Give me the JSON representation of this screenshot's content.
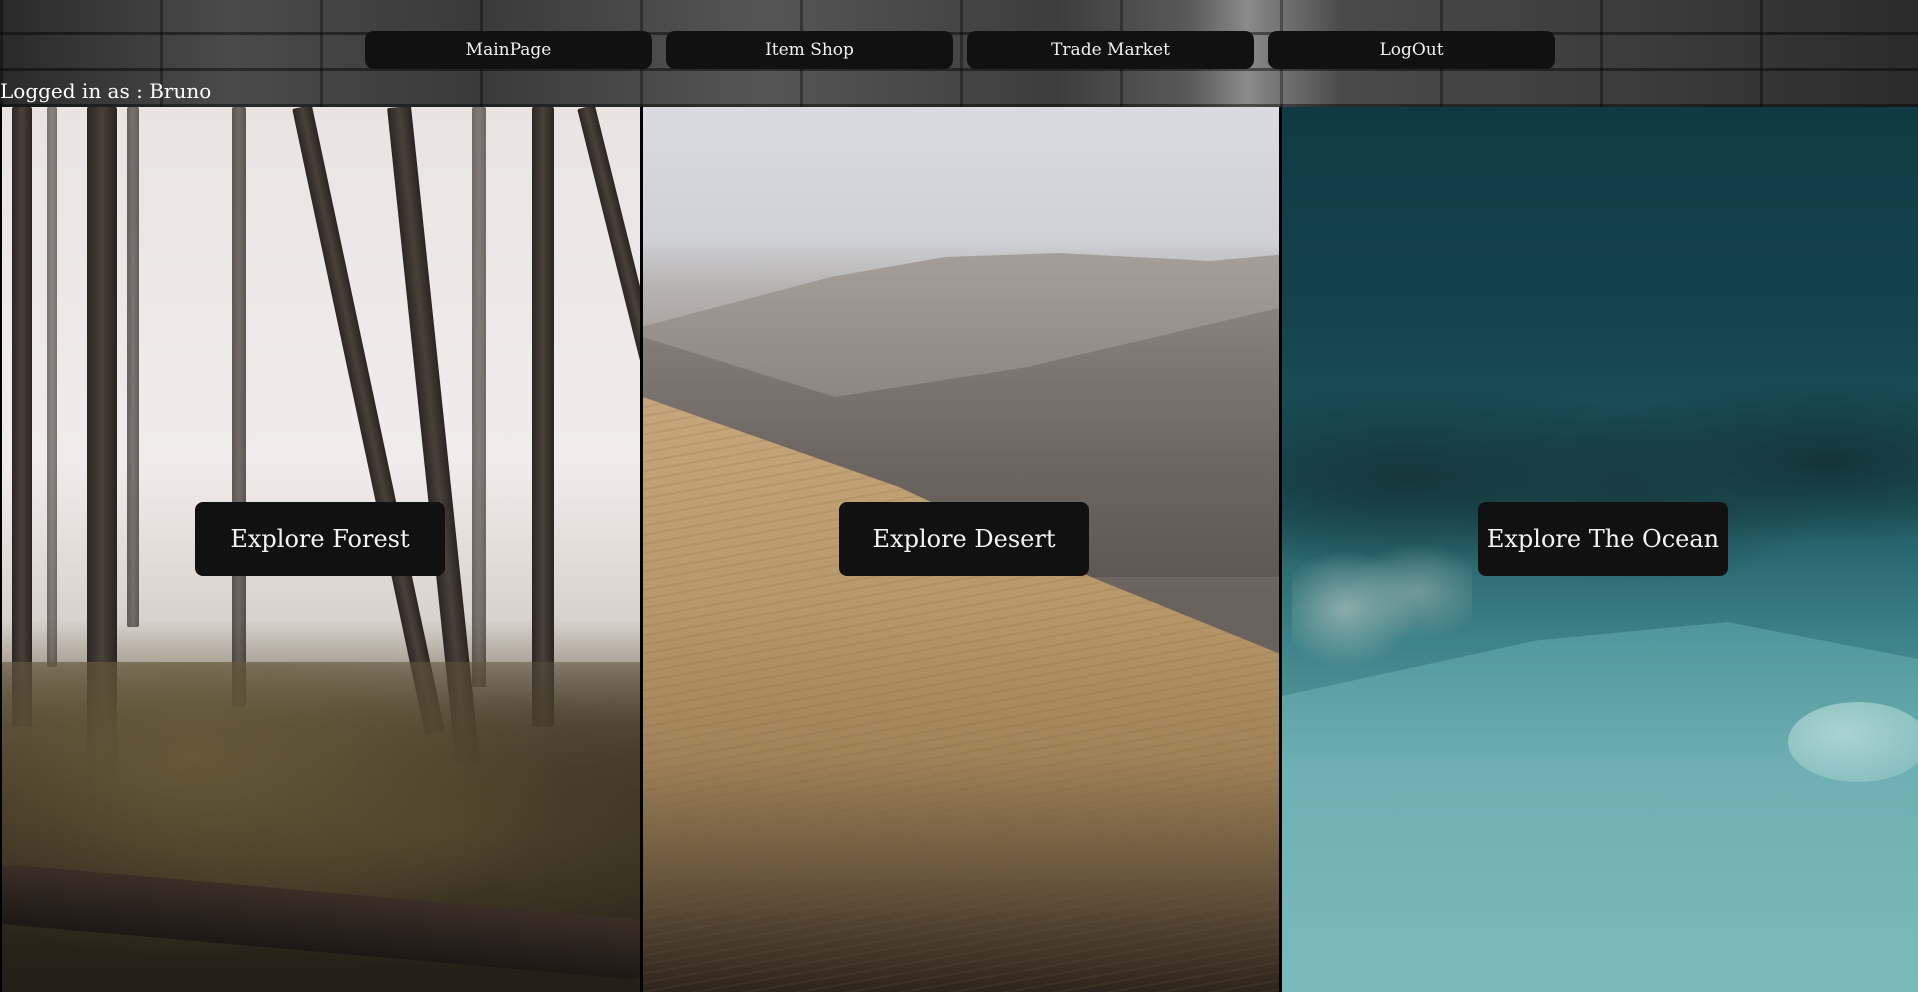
{
  "nav": {
    "items": [
      {
        "label": "MainPage"
      },
      {
        "label": "Item Shop"
      },
      {
        "label": "Trade Market"
      },
      {
        "label": "LogOut"
      }
    ]
  },
  "user": {
    "status": "Logged in as : Bruno"
  },
  "panels": [
    {
      "scene": "forest",
      "button_label": "Explore Forest"
    },
    {
      "scene": "desert",
      "button_label": "Explore Desert"
    },
    {
      "scene": "ocean",
      "button_label": "Explore The Ocean"
    }
  ],
  "colors": {
    "button_bg": "#111111",
    "button_text": "#f4f4f4",
    "header_bg": "#3c3c3c"
  }
}
